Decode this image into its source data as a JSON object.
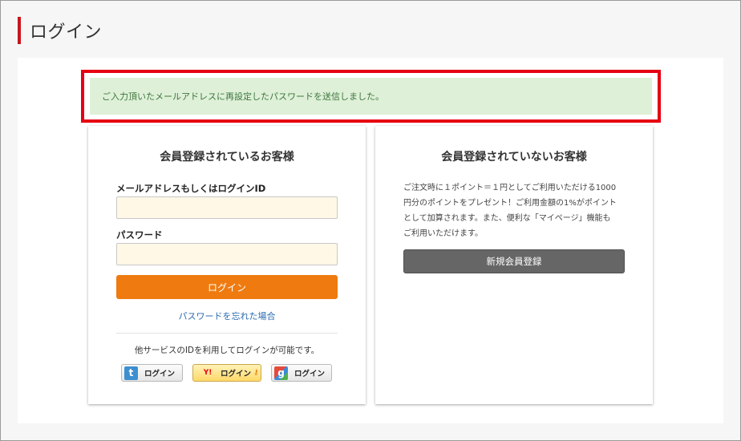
{
  "page": {
    "title": "ログイン"
  },
  "alert": {
    "message": "ご入力頂いたメールアドレスに再設定したパスワードを送信しました。"
  },
  "member": {
    "heading": "会員登録されているお客様",
    "email_label": "メールアドレスもしくはログインID",
    "email_value": "",
    "password_label": "パスワード",
    "password_value": "",
    "login_button": "ログイン",
    "forgot_link": "パスワードを忘れた場合",
    "social_text": "他サービスのIDを利用してログインが可能です。",
    "social_buttons": [
      {
        "service": "twitter",
        "icon": "twitter-icon",
        "label": "ログイン"
      },
      {
        "service": "yahoo",
        "icon": "yahoo-icon",
        "icon_text": "Y!",
        "label": "ログイン"
      },
      {
        "service": "google",
        "icon": "google-icon",
        "label": "ログイン"
      }
    ]
  },
  "guest": {
    "heading": "会員登録されていないお客様",
    "description_lines": [
      "ご注文時に１ポイント＝１円としてご利用いただける1000",
      "円分のポイントをプレゼント！ご利用金額の1%がポイント",
      "として加算されます。また、便利な「マイページ」機能も",
      "ご利用いただけます。"
    ],
    "register_button": "新規会員登録"
  },
  "colors": {
    "accent_red": "#c8161d",
    "highlight_border": "#e60012",
    "alert_bg": "#dff0d8",
    "alert_text": "#3c763d",
    "login_orange": "#ef7b10",
    "input_bg": "#fff8e6",
    "register_gray": "#666666",
    "link_blue": "#2a6bb0"
  }
}
